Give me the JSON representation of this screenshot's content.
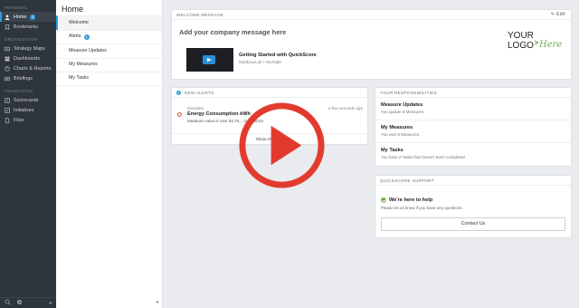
{
  "sidebar": {
    "sections": [
      "PERSONAL",
      "ORGANIZATION",
      "FOUNDATION"
    ],
    "personal": [
      {
        "label": "Home",
        "badge": "1",
        "icon": "user-icon"
      },
      {
        "label": "Bookmarks",
        "icon": "bookmark-icon"
      }
    ],
    "organization": [
      {
        "label": "Strategy Maps",
        "icon": "map-icon"
      },
      {
        "label": "Dashboards",
        "icon": "dashboard-icon"
      },
      {
        "label": "Charts & Reports",
        "icon": "chart-icon"
      },
      {
        "label": "Briefings",
        "icon": "briefing-icon"
      }
    ],
    "foundation": [
      {
        "label": "Scorecards",
        "icon": "scorecard-icon"
      },
      {
        "label": "Initiatives",
        "icon": "initiative-icon"
      },
      {
        "label": "Files",
        "icon": "file-icon"
      }
    ]
  },
  "subnav": {
    "title": "Home",
    "items": [
      {
        "label": "Welcome"
      },
      {
        "label": "Alerts",
        "badge": "1"
      },
      {
        "label": "Measure Updates"
      },
      {
        "label": "My Measures"
      },
      {
        "label": "My Tasks"
      }
    ]
  },
  "welcome": {
    "header": "WELCOME MESSAGE",
    "edit": "Edit",
    "company_message": "Add your company message here",
    "video_title": "Getting Started with QuickScore",
    "video_source": "intrafocus.uk / YouTube",
    "logo_text": "YOUR LOGO Here"
  },
  "alerts": {
    "count": "1",
    "header": "NEW ALERTS",
    "group": "Samples",
    "time": "a few seconds ago",
    "title": "Energy Consumption kWh",
    "text": "Measure value is now 53,76... June 2019",
    "show_all": "Show All Alerts"
  },
  "responsibilities": {
    "header": "YOUR RESPONSIBILITIES",
    "items": [
      {
        "title": "Measure Updates",
        "sub": "You update 6 Measures."
      },
      {
        "title": "My Measures",
        "sub": "You own 8 Measures."
      },
      {
        "title": "My Tasks",
        "sub": "You have 2 Tasks that haven't been completed."
      }
    ]
  },
  "support": {
    "header": "QUICKSCORE SUPPORT",
    "title": "We're here to help",
    "text": "Please let us know if you have any questions.",
    "button": "Contact Us"
  },
  "colors": {
    "accent": "#2d9cdb",
    "sidebar_bg": "#2f353c",
    "overlay_red": "#e23b2e"
  }
}
